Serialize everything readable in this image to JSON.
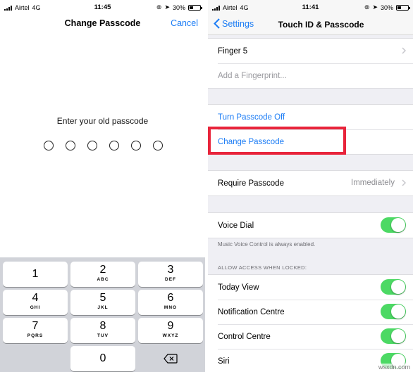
{
  "left": {
    "status": {
      "carrier": "Airtel",
      "network": "4G",
      "time": "11:45",
      "battery": "30%"
    },
    "nav": {
      "title": "Change Passcode",
      "cancel": "Cancel"
    },
    "prompt": "Enter your old passcode",
    "keys": [
      {
        "num": "1",
        "letters": ""
      },
      {
        "num": "2",
        "letters": "ABC"
      },
      {
        "num": "3",
        "letters": "DEF"
      },
      {
        "num": "4",
        "letters": "GHI"
      },
      {
        "num": "5",
        "letters": "JKL"
      },
      {
        "num": "6",
        "letters": "MNO"
      },
      {
        "num": "7",
        "letters": "PQRS"
      },
      {
        "num": "8",
        "letters": "TUV"
      },
      {
        "num": "9",
        "letters": "WXYZ"
      },
      {
        "num": "0",
        "letters": ""
      }
    ]
  },
  "right": {
    "status": {
      "carrier": "Airtel",
      "network": "4G",
      "time": "11:41",
      "battery": "30%"
    },
    "nav": {
      "back": "Settings",
      "title": "Touch ID & Passcode"
    },
    "fingerprints": {
      "finger5": "Finger 5",
      "add": "Add a Fingerprint..."
    },
    "passcode": {
      "turn_off": "Turn Passcode Off",
      "change": "Change Passcode"
    },
    "require": {
      "label": "Require Passcode",
      "value": "Immediately"
    },
    "voice_dial": {
      "label": "Voice Dial",
      "footnote": "Music Voice Control is always enabled."
    },
    "locked": {
      "header": "ALLOW ACCESS WHEN LOCKED:",
      "items": [
        "Today View",
        "Notification Centre",
        "Control Centre",
        "Siri"
      ]
    }
  },
  "colors": {
    "accent": "#1b7cf5",
    "toggle_on": "#4cd964",
    "highlight": "#e8243b"
  },
  "watermark": "wsxdn.com"
}
